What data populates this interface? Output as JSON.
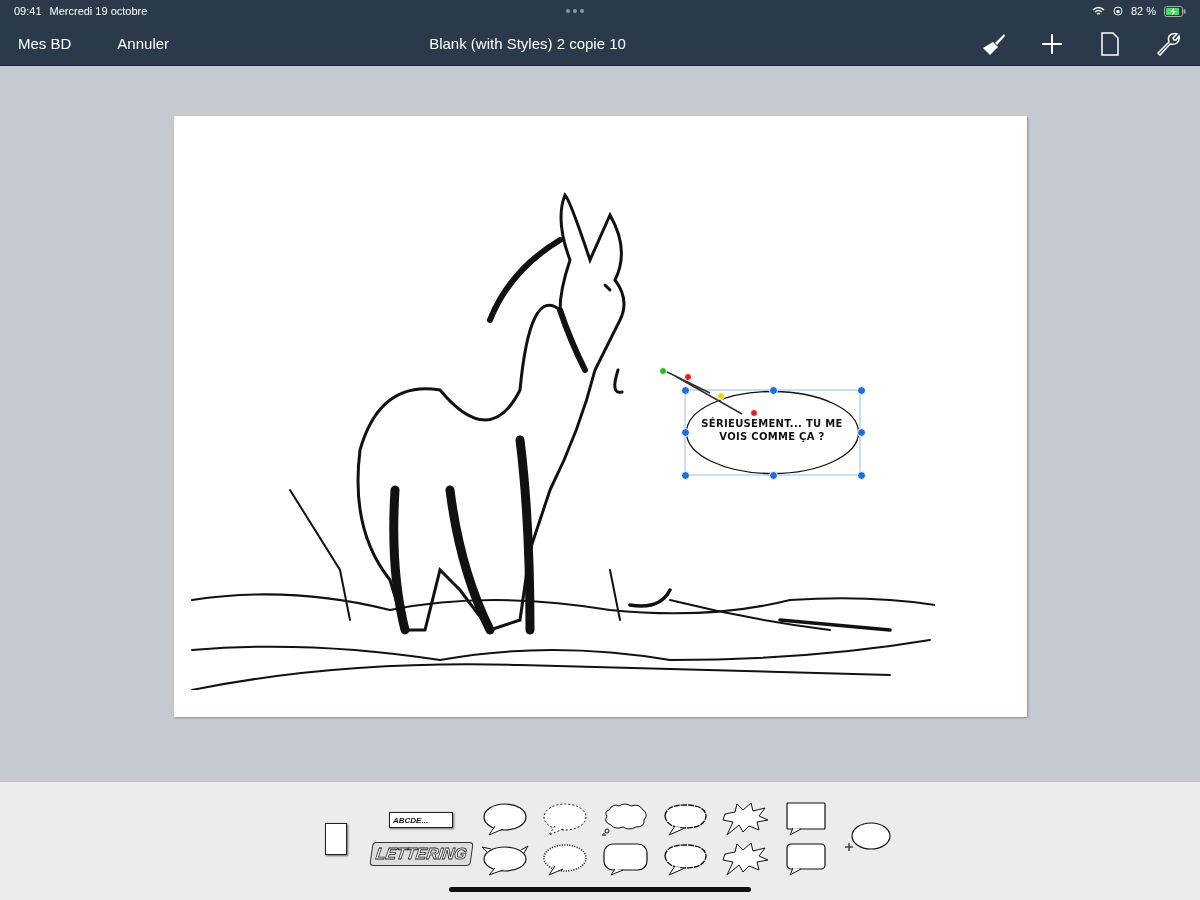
{
  "status_bar": {
    "time": "09:41",
    "date": "Mercredi 19 octobre",
    "battery": "82 %"
  },
  "nav_bar": {
    "left_buttons": [
      "Mes BD",
      "Annuler"
    ],
    "title": "Blank (with Styles) 2 copie 10"
  },
  "canvas": {
    "speech_bubble": {
      "text": "SÉRIEUSEMENT... TU ME VOIS COMME ÇA ?",
      "selected": true
    }
  },
  "palette": {
    "columns": [
      {
        "items": [
          {
            "kind": "panel"
          }
        ]
      },
      {
        "items": [
          {
            "kind": "caption",
            "text": "ABCDE..."
          },
          {
            "kind": "lettering",
            "text": "LETTERING"
          }
        ]
      },
      {
        "items": [
          {
            "kind": "oval"
          },
          {
            "kind": "spiky-oval"
          }
        ]
      },
      {
        "items": [
          {
            "kind": "dashed"
          },
          {
            "kind": "zigzag"
          }
        ]
      },
      {
        "items": [
          {
            "kind": "cloud"
          },
          {
            "kind": "rounded"
          }
        ]
      },
      {
        "items": [
          {
            "kind": "rough"
          },
          {
            "kind": "rough"
          }
        ]
      },
      {
        "items": [
          {
            "kind": "burst"
          },
          {
            "kind": "burst"
          }
        ]
      },
      {
        "items": [
          {
            "kind": "rect"
          },
          {
            "kind": "rect-rounded"
          }
        ]
      },
      {
        "items": [
          {
            "kind": "add"
          }
        ]
      }
    ]
  }
}
